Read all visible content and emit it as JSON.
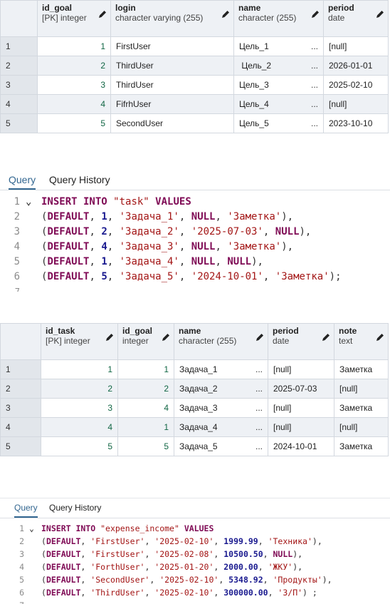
{
  "goal_table": {
    "columns": [
      {
        "name": "id_goal",
        "type": "[PK] integer"
      },
      {
        "name": "login",
        "type": "character varying (255)"
      },
      {
        "name": "name",
        "type": "character (255)"
      },
      {
        "name": "period",
        "type": "date"
      }
    ],
    "rows": [
      {
        "n": "1",
        "id_goal": "1",
        "login": "FirstUser",
        "name": "Цель_1",
        "period": "[null]"
      },
      {
        "n": "2",
        "id_goal": "2",
        "login": "ThirdUser",
        "name": " Цель_2",
        "period": "2026-01-01"
      },
      {
        "n": "3",
        "id_goal": "3",
        "login": "ThirdUser",
        "name": "Цель_3",
        "period": "2025-02-10"
      },
      {
        "n": "4",
        "id_goal": "4",
        "login": "FifrhUser",
        "name": "Цель_4",
        "period": "[null]"
      },
      {
        "n": "5",
        "id_goal": "5",
        "login": "SecondUser",
        "name": "Цель_5",
        "period": "2023-10-10"
      }
    ],
    "ellipsis": "..."
  },
  "query1": {
    "tab_query": "Query",
    "tab_history": "Query History",
    "line_numbers": [
      "1",
      "2",
      "3",
      "4",
      "5",
      "6",
      "7"
    ],
    "fold_icon": "chevron-down"
  },
  "task_table": {
    "columns": [
      {
        "name": "id_task",
        "type": "[PK] integer"
      },
      {
        "name": "id_goal",
        "type": "integer"
      },
      {
        "name": "name",
        "type": "character (255)"
      },
      {
        "name": "period",
        "type": "date"
      },
      {
        "name": "note",
        "type": "text"
      }
    ],
    "rows": [
      {
        "n": "1",
        "id_task": "1",
        "id_goal": "1",
        "name": "Задача_1",
        "period": "[null]",
        "note": "Заметка"
      },
      {
        "n": "2",
        "id_task": "2",
        "id_goal": "2",
        "name": "Задача_2",
        "period": "2025-07-03",
        "note": "[null]"
      },
      {
        "n": "3",
        "id_task": "3",
        "id_goal": "4",
        "name": "Задача_3",
        "period": "[null]",
        "note": "Заметка"
      },
      {
        "n": "4",
        "id_task": "4",
        "id_goal": "1",
        "name": "Задача_4",
        "period": "[null]",
        "note": "[null]"
      },
      {
        "n": "5",
        "id_task": "5",
        "id_goal": "5",
        "name": "Задача_5",
        "period": "2024-10-01",
        "note": "Заметка"
      }
    ],
    "ellipsis": "..."
  },
  "query2": {
    "tab_query": "Query",
    "tab_history": "Query History",
    "line_numbers": [
      "1",
      "2",
      "3",
      "4",
      "5",
      "6",
      "7"
    ]
  },
  "colors": {
    "keyword": "#7f0a55",
    "string": "#a31515",
    "tab_active": "#326690",
    "header_bg": "#eef1f5"
  }
}
